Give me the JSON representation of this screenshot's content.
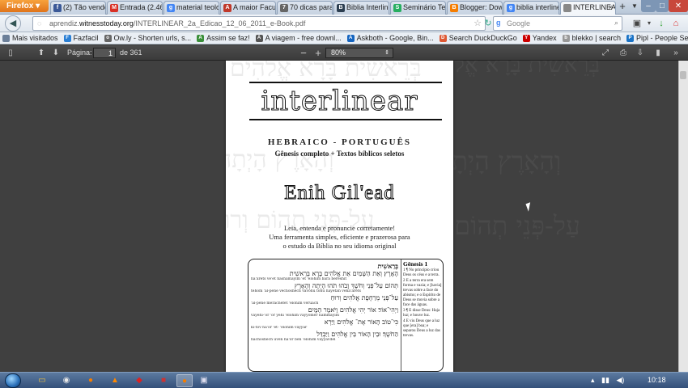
{
  "browser": {
    "menu_button": "Firefox",
    "tabs": [
      {
        "label": "(2) Tão vendo...",
        "icon": "facebook-icon",
        "color": "#3b5998",
        "glyph": "f"
      },
      {
        "label": "Entrada (2.461...",
        "icon": "gmail-icon",
        "color": "#d93025",
        "glyph": "M"
      },
      {
        "label": "material teolo...",
        "icon": "google-icon",
        "color": "#4285f4",
        "glyph": "g"
      },
      {
        "label": "A maior Facul...",
        "icon": "page-icon",
        "color": "#c0392b",
        "glyph": "A"
      },
      {
        "label": "70 dicas para ...",
        "icon": "page-icon",
        "color": "#666666",
        "glyph": "7"
      },
      {
        "label": "Biblia Interline...",
        "icon": "bible-icon",
        "color": "#2c3e50",
        "glyph": "B"
      },
      {
        "label": "Seminário Te...",
        "icon": "seminary-icon",
        "color": "#27ae60",
        "glyph": "S"
      },
      {
        "label": "Blogger: Dow...",
        "icon": "blogger-icon",
        "color": "#f57d00",
        "glyph": "B"
      },
      {
        "label": "biblia interline...",
        "icon": "google-icon",
        "color": "#4285f4",
        "glyph": "g"
      },
      {
        "label": "INTERLINEAR...",
        "icon": "pdf-icon",
        "color": "#888888",
        "glyph": "",
        "active": true
      }
    ],
    "new_tab": "+",
    "url_prefix": "aprendiz.",
    "url_domain": "witnesstoday.org",
    "url_rest": "/INTERLINEAR_2a_Edicao_12_06_2011_e-Book.pdf",
    "search_placeholder": "Google"
  },
  "bookmarks": [
    {
      "label": "Mais visitados",
      "icon": "bookmark-icon",
      "color": "#6b7f99",
      "glyph": ""
    },
    {
      "label": "Fazfacil",
      "icon": "fazfacil-icon",
      "color": "#2a7fd4",
      "glyph": "F"
    },
    {
      "label": "Ow.ly - Shorten urls, s...",
      "icon": "owly-icon",
      "color": "#666666",
      "glyph": "o"
    },
    {
      "label": "Assim se faz!",
      "icon": "page-icon",
      "color": "#3a8f3a",
      "glyph": "A"
    },
    {
      "label": "A viagem - free downl...",
      "icon": "page-icon",
      "color": "#555555",
      "glyph": "A"
    },
    {
      "label": "Askboth - Google, Bin...",
      "icon": "askboth-icon",
      "color": "#1565c0",
      "glyph": "A"
    },
    {
      "label": "Search DuckDuckGo",
      "icon": "duckduckgo-icon",
      "color": "#de5833",
      "glyph": "D"
    },
    {
      "label": "Yandex",
      "icon": "yandex-icon",
      "color": "#cc0000",
      "glyph": "Y"
    },
    {
      "label": "blekko | search",
      "icon": "blekko-icon",
      "color": "#999999",
      "glyph": "b"
    },
    {
      "label": "Pipl - People Search",
      "icon": "pipl-icon",
      "color": "#1a73c6",
      "glyph": "P"
    }
  ],
  "pdf_viewer": {
    "page_label": "Página:",
    "page_number": "1",
    "page_total": "de 361",
    "zoom": "80%"
  },
  "document": {
    "title": "interlinear",
    "subtitle": "HEBRAICO - PORTUGUÊS",
    "subtitle2": "Gênesis completo + Textos bíblicos seletos",
    "author": "Enih Gil'ead",
    "tagline1": "Leia, entenda e pronuncie corretamente!",
    "tagline2": "Uma ferramenta simples, eficiente e prazerosa para",
    "tagline3": "o estudo da Bíblia no seu idioma original",
    "bg_hebrew": [
      "בְּרֵאשִׁית בָּרָא אֱלֹהִים",
      "וְהָאָרֶץ הָיְתָה",
      "עַל-פְּנֵי תְהוֹם וְרוּחַ"
    ],
    "sample": {
      "heading": "Gênesis 1",
      "top_word": "בְּרֵאשִׁית",
      "hebrew_rows": [
        "הָאָרֶץ׃ וְאֵת הַשָּׁמַיִם אֵת אֱלֹהִים בָּרָא בְּרֵאשִׁית",
        "תְּהוֹם עַל־פְּנֵי וְחֹשֶׁךְ וָבֹהוּ תֹהוּ הָיְתָה וְהָאָרֶץ",
        "עַל־פְּנֵי מְרַחֶפֶת אֱלֹהִים וְרוּחַ",
        "וַיְהִי־אוֹר׃ אוֹר יְהִי אֱלֹהִים וַיֹּאמֶר הַמָּיִם׃",
        "כִּי־טוֹב הָאוֹר אֶת־ אֱלֹהִים וַיַּרְא",
        "הַחֹשֶׁךְ׃ וּבֵין הָאוֹר בֵּין אֱלֹהִים וַיַּבְדֵּל"
      ],
      "translit_rows": [
        "ha'árets ve'et hashamáyim 'et 'elohim bará bereshít",
        "tehóm 'al-penê vechóshech vavôhu tóhu hayetáh veha'árets",
        "'al-penê merachéfet 'elohim verúach",
        "vayehí-'or 'or yehí 'elohim vayyómer hammáyim",
        "ki-tov ha'or 'et- 'elohim vayyár",
        "hachóshech uvên ha'or bên 'elohim vayyavdél"
      ],
      "right_text": [
        "1 ¶ No princípio criou Deus os céus e a terra.",
        "2 E a terra era sem forma e vazia; e [havia] trevas sobre a face do abismo; e o Espírito de Deus se movia sobre a face das águas.",
        "3 ¶ E disse Deus: Haja luz; e houve luz.",
        "4 E viu Deus que a luz que [era] boa; e separou Deus a luz das trevas."
      ]
    }
  },
  "taskbar": {
    "apps": [
      {
        "name": "explorer-icon",
        "glyph": "▭",
        "color": "#f0c040"
      },
      {
        "name": "chrome-icon",
        "glyph": "◉",
        "color": "#e8e8e8"
      },
      {
        "name": "firefox-icon",
        "glyph": "●",
        "color": "#f57d00"
      },
      {
        "name": "vlc-icon",
        "glyph": "▲",
        "color": "#ff8800"
      },
      {
        "name": "acrobat-icon",
        "glyph": "◆",
        "color": "#d22"
      },
      {
        "name": "pdf-icon",
        "glyph": "■",
        "color": "#c33"
      },
      {
        "name": "firefox-icon",
        "glyph": "●",
        "color": "#f57d00",
        "active": true
      },
      {
        "name": "window-icon",
        "glyph": "▣",
        "color": "#dde"
      }
    ],
    "clock": "10:18"
  }
}
